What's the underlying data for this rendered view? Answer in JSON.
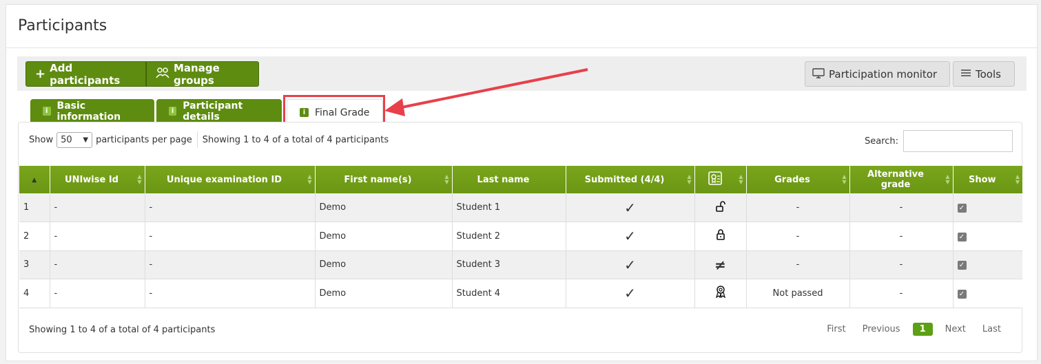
{
  "page": {
    "title": "Participants"
  },
  "toolbar": {
    "add_participants": "Add participants",
    "manage_groups": "Manage groups",
    "participation_monitor": "Participation monitor",
    "tools": "Tools"
  },
  "tabs": [
    {
      "label": "Basic information",
      "icon": "info-icon"
    },
    {
      "label": "Participant details",
      "icon": "info-icon"
    },
    {
      "label": "Final Grade",
      "icon": "info-icon",
      "active": true
    }
  ],
  "list_controls": {
    "show_label": "Show",
    "per_page_value": "50",
    "per_page_suffix": "participants per page",
    "info": "Showing 1 to 4 of a total of 4 participants",
    "search_label": "Search:",
    "search_value": ""
  },
  "table": {
    "columns": [
      "",
      "UNIwise Id",
      "Unique examination ID",
      "First name(s)",
      "Last name",
      "Submitted (4/4)",
      "",
      "Grades",
      "Alternative grade",
      "Show"
    ],
    "rows": [
      {
        "num": "1",
        "uniwise": "-",
        "exam_id": "-",
        "first": "Demo",
        "last": "Student 1",
        "submitted": "✓",
        "status": "unlock-icon",
        "grades": "-",
        "alt": "-",
        "show": true
      },
      {
        "num": "2",
        "uniwise": "-",
        "exam_id": "-",
        "first": "Demo",
        "last": "Student 2",
        "submitted": "✓",
        "status": "lock-icon",
        "grades": "-",
        "alt": "-",
        "show": true
      },
      {
        "num": "3",
        "uniwise": "-",
        "exam_id": "-",
        "first": "Demo",
        "last": "Student 3",
        "submitted": "✓",
        "status": "not-equal-icon",
        "grades": "-",
        "alt": "-",
        "show": true
      },
      {
        "num": "4",
        "uniwise": "-",
        "exam_id": "-",
        "first": "Demo",
        "last": "Student 4",
        "submitted": "✓",
        "status": "award-icon",
        "grades": "Not passed",
        "alt": "-",
        "show": true
      }
    ]
  },
  "footer": {
    "info": "Showing 1 to 4 of a total of 4 participants",
    "pager": {
      "first": "First",
      "previous": "Previous",
      "current": "1",
      "next": "Next",
      "last": "Last"
    }
  },
  "colors": {
    "accent": "#5e8c10",
    "highlight": "#e8404a"
  }
}
